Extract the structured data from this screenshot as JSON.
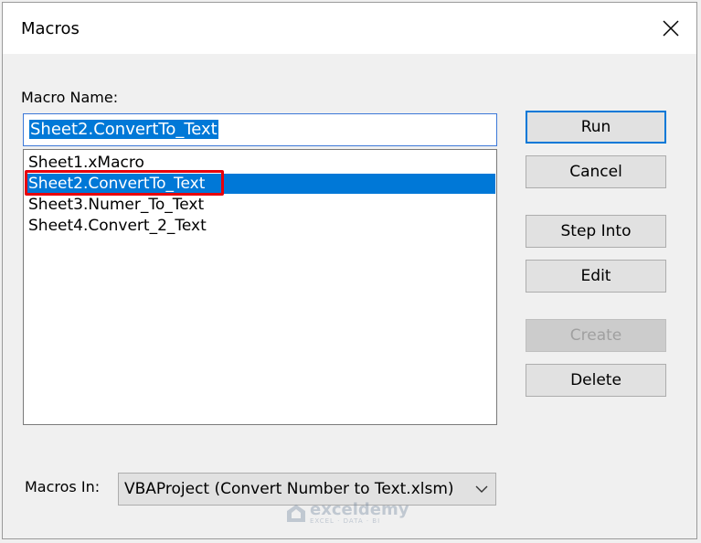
{
  "window": {
    "title": "Macros"
  },
  "macro_name": {
    "label": "Macro Name:",
    "value": "Sheet2.ConvertTo_Text"
  },
  "macros": [
    {
      "label": "Sheet1.xMacro",
      "selected": false
    },
    {
      "label": "Sheet2.ConvertTo_Text",
      "selected": true
    },
    {
      "label": "Sheet3.Numer_To_Text",
      "selected": false
    },
    {
      "label": "Sheet4.Convert_2_Text",
      "selected": false
    }
  ],
  "buttons": {
    "run": "Run",
    "cancel": "Cancel",
    "step_into": "Step Into",
    "edit": "Edit",
    "create": "Create",
    "delete": "Delete"
  },
  "macros_in": {
    "label": "Macros In:",
    "value": "VBAProject (Convert Number to Text.xlsm)"
  },
  "watermark": {
    "brand": "exceldemy",
    "tagline": "EXCEL · DATA · BI"
  },
  "colors": {
    "selection": "#0078d7",
    "highlight": "#e8000b"
  }
}
